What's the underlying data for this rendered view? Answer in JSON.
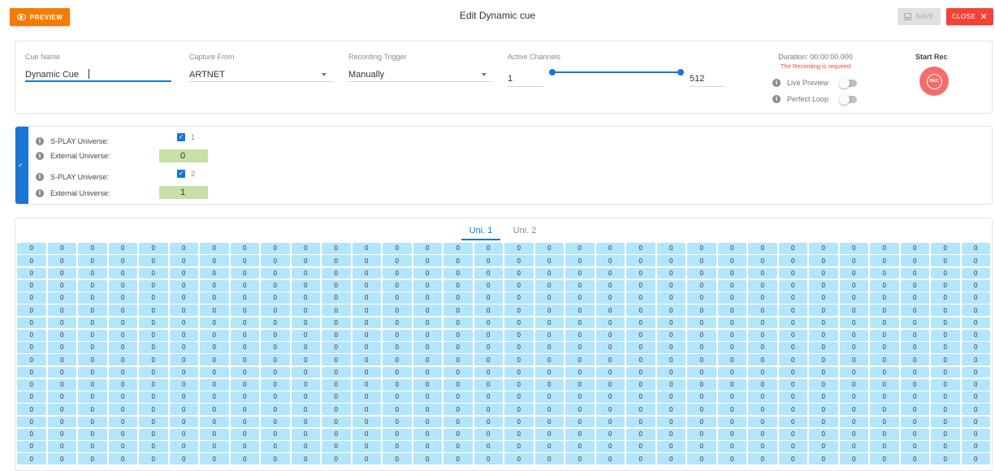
{
  "header": {
    "preview_label": "PREVIEW",
    "title": "Edit Dynamic cue",
    "save_label": "SAVE",
    "close_label": "CLOSE"
  },
  "settings": {
    "cue_name_label": "Cue Name",
    "cue_name_value": "Dynamic Cue",
    "capture_from_label": "Capture From",
    "capture_from_value": "ARTNET",
    "recording_trigger_label": "Recording Trigger",
    "recording_trigger_value": "Manually",
    "active_channels_label": "Active Channels",
    "channels_min": "1",
    "channels_max": "512",
    "duration": "Duration: 00:00:00.000",
    "recording_required": "The Recording is required",
    "live_preview_label": "Live Preview",
    "live_preview_on": false,
    "perfect_loop_label": "Perfect Loop",
    "perfect_loop_on": false,
    "start_rec_label": "Start Rec",
    "rec_label": "REC"
  },
  "universes": [
    {
      "splay_label": "S-PLAY Universe:",
      "splay_value": "1",
      "checked": true,
      "external_label": "External Universe:",
      "external_value": "0"
    },
    {
      "splay_label": "S-PLAY Universe:",
      "splay_value": "2",
      "checked": true,
      "external_label": "External Universe:",
      "external_value": "1"
    }
  ],
  "grid": {
    "tabs": [
      {
        "label": "Uni. 1",
        "active": true
      },
      {
        "label": "Uni. 2",
        "active": false
      }
    ],
    "columns": 32,
    "visible_rows": 18,
    "cell_value": "0"
  },
  "colors": {
    "primary": "#1976d2",
    "preview": "#f57c00",
    "close": "#f44336",
    "rec": "#f66b6b",
    "cell": "#b3e5fc",
    "external_box": "#c5e1a5"
  }
}
